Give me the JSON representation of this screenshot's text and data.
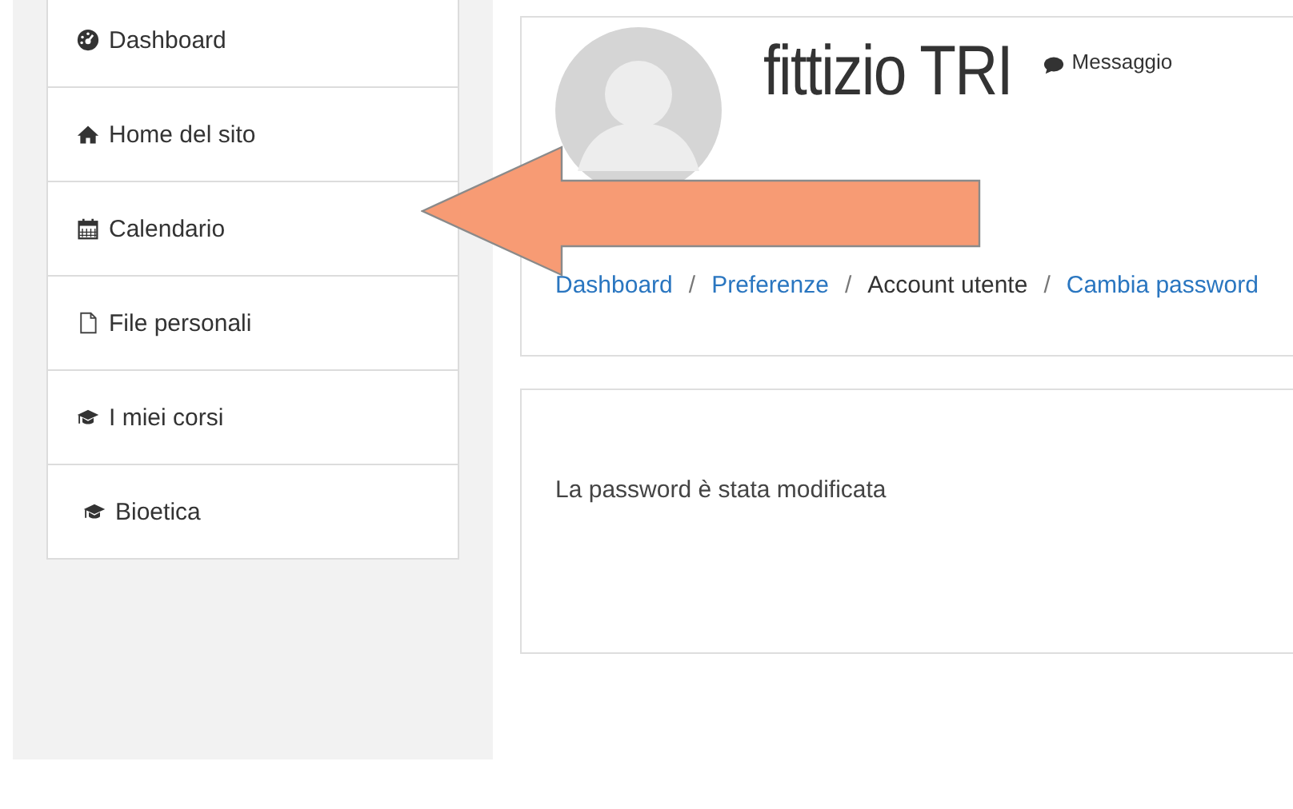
{
  "sidebar": {
    "items": [
      {
        "label": "Dashboard",
        "kind": "dashboard"
      },
      {
        "label": "Home del sito",
        "kind": "home"
      },
      {
        "label": "Calendario",
        "kind": "calendar"
      },
      {
        "label": "File personali",
        "kind": "file"
      },
      {
        "label": "I miei corsi",
        "kind": "course"
      },
      {
        "label": "Bioetica",
        "kind": "course"
      }
    ]
  },
  "profile": {
    "name": "fittizio TRI",
    "message_button": "Messaggio"
  },
  "breadcrumb": [
    {
      "kind": "link",
      "text": "Dashboard"
    },
    {
      "kind": "separator",
      "text": "/"
    },
    {
      "kind": "link",
      "text": "Preferenze"
    },
    {
      "kind": "separator",
      "text": "/"
    },
    {
      "kind": "current",
      "text": "Account utente"
    },
    {
      "kind": "separator",
      "text": "/"
    },
    {
      "kind": "link",
      "text": "Cambia password"
    }
  ],
  "notice": {
    "text": "La password è stata modificata"
  }
}
